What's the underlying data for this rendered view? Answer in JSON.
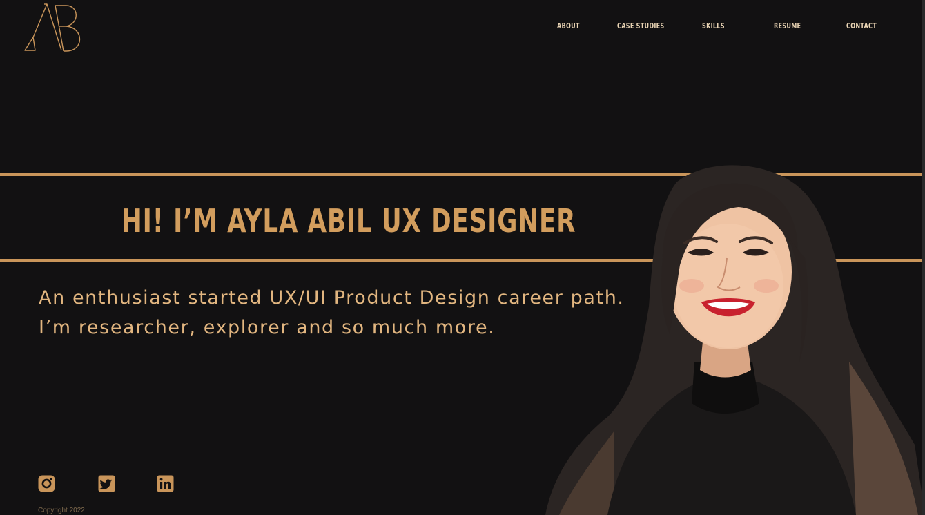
{
  "header": {
    "logo_alt": "AB"
  },
  "nav": {
    "items": [
      {
        "label": "ABOUT"
      },
      {
        "label": "CASE STUDIES"
      },
      {
        "label": "SKILLS"
      },
      {
        "label": "RESUME"
      },
      {
        "label": "CONTACT"
      }
    ]
  },
  "hero": {
    "headline": "HI! I’M AYLA ABIL UX DESIGNER",
    "tagline_line1": "An enthusiast started UX/UI Product Design career path.",
    "tagline_line2": "I’m researcher, explorer and so much more."
  },
  "socials": [
    {
      "icon": "instagram-icon"
    },
    {
      "icon": "twitter-icon"
    },
    {
      "icon": "linkedin-icon"
    }
  ],
  "footer": {
    "copyright": "Copyright 2022"
  },
  "colors": {
    "background": "#121112",
    "accent": "#c9955a",
    "headline": "#d29d5d",
    "tagline": "#e2b680"
  }
}
